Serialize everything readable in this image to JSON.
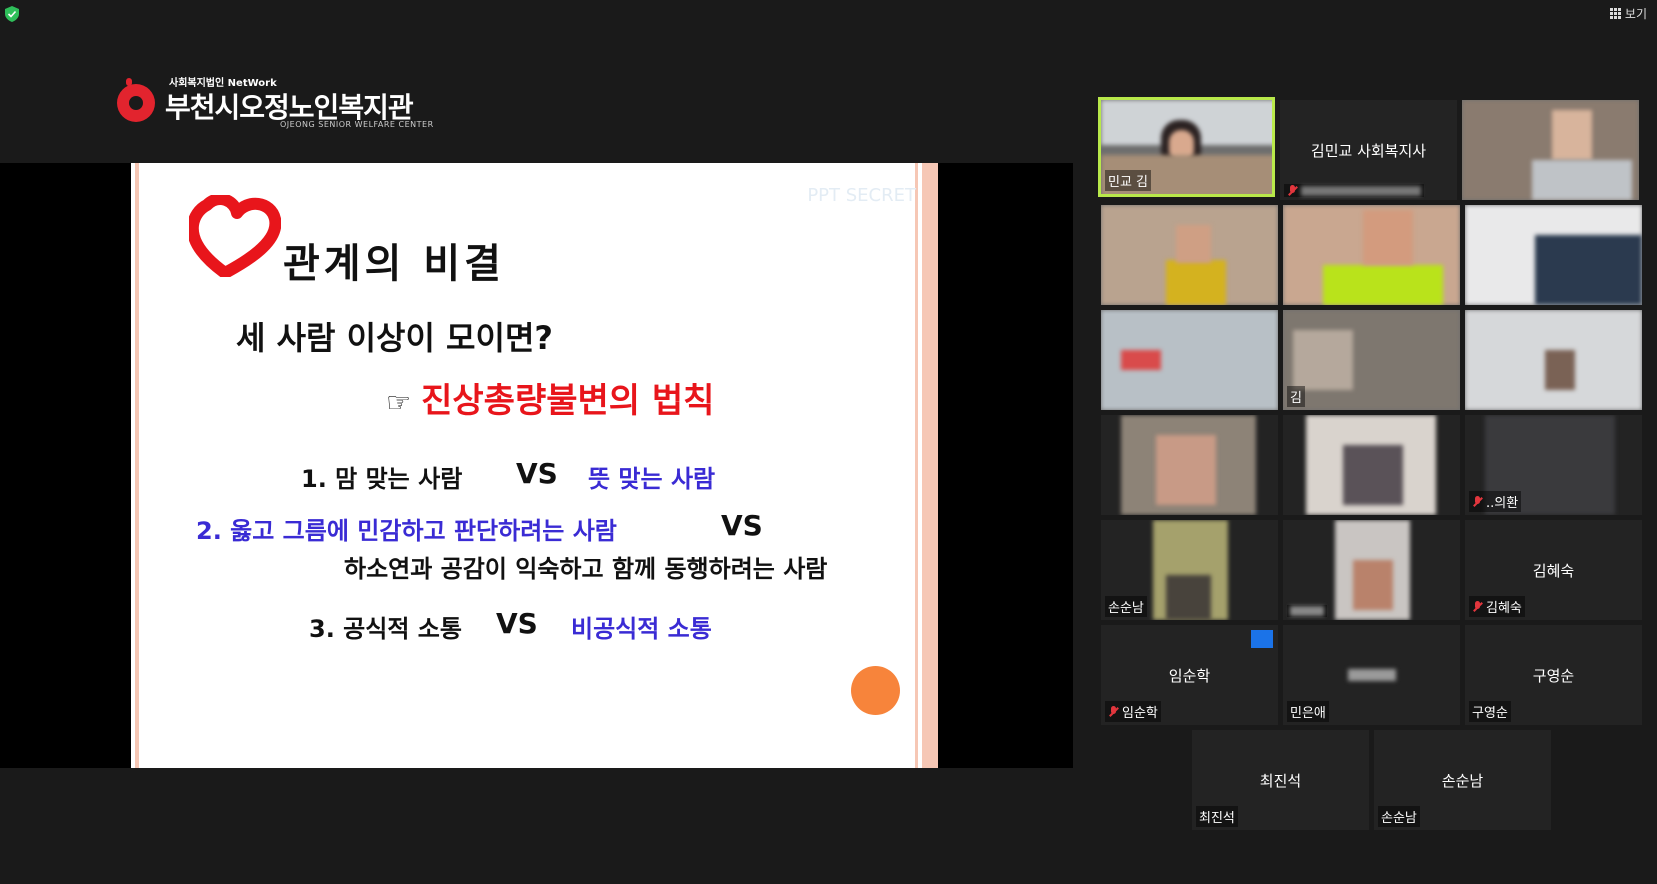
{
  "toolbar": {
    "view_label": "보기"
  },
  "logo": {
    "tagline": "사회복지법인 NetWork",
    "name": "부천시오정노인복지관",
    "english": "OJEONG SENIOR WELFARE CENTER"
  },
  "slide": {
    "watermark": "PPT SECRET",
    "title": "관계의 비결",
    "question": "세 사람 이상이 모이면?",
    "hand": "☞",
    "law": "진상총량불변의 법칙",
    "item1_left": "1. 맘 맞는 사람",
    "item1_vs": "VS",
    "item1_right": "뜻 맞는 사람",
    "item2_left": "2. 옳고 그름에 민감하고 판단하려는 사람",
    "item2_vs": "VS",
    "item2_right": "하소연과 공감이 익숙하고 함께 동행하려는 사람",
    "item3_left": "3. 공식적 소통",
    "item3_vs": "VS",
    "item3_right": "비공식적 소통"
  },
  "participants": {
    "p1": "민교 김",
    "p2_center": "김민교 사회복지사",
    "p12": "..의환",
    "p13": "손순남",
    "p15_center": "김혜숙",
    "p15": "김혜숙",
    "p16_center": "임순학",
    "p16": "임순학",
    "p17": "민은애",
    "p18_center": "구영순",
    "p18": "구영순",
    "p19_center": "최진석",
    "p19": "최진석",
    "p20_center": "손순남",
    "p20": "손순남",
    "p8": "김"
  },
  "colors": {
    "accent_red": "#e8151b",
    "accent_blue": "#3a2bd4",
    "active_border": "#b8e84a",
    "background": "#1a1a1a"
  }
}
